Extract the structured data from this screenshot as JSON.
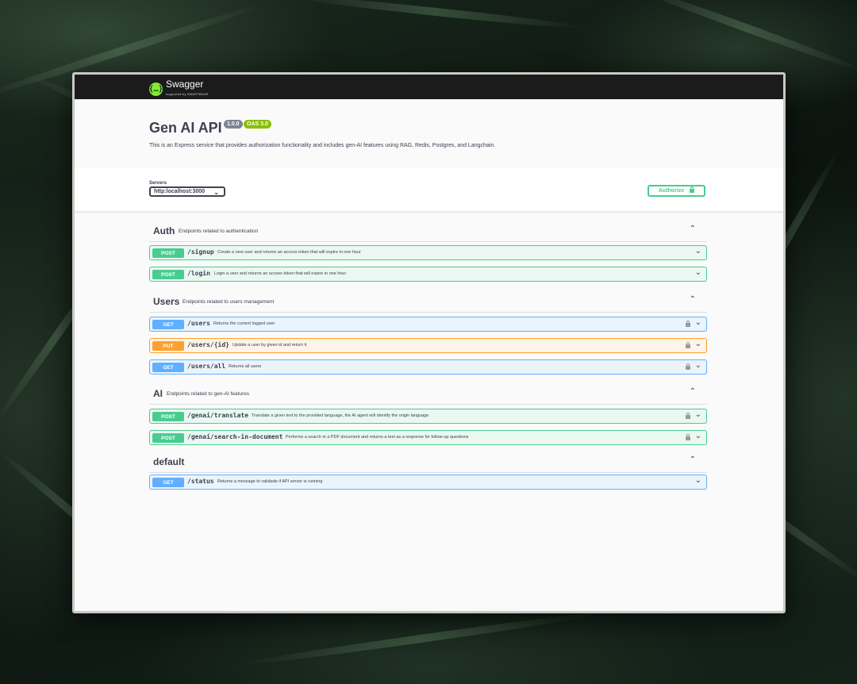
{
  "header": {
    "logo_text": "Swagger",
    "logo_sub": "supported by SMARTBEAR",
    "logo_mark": "{…}"
  },
  "info": {
    "title": "Gen AI API",
    "version": "1.0.0",
    "oas": "OAS 3.0",
    "description": "This is an Express service that provides authorization functionality and includes gen-AI features using RAG, Redis, Postgres, and Langchain."
  },
  "servers": {
    "label": "Servers",
    "selected": "http:localhost:3000"
  },
  "authorize": {
    "label": "Authorize"
  },
  "tags": [
    {
      "name": "Auth",
      "description": "Endpoints related to authentication",
      "ops": [
        {
          "method": "POST",
          "path": "/signup",
          "summary": "Create a new user and returns an access token that will expire in one hour",
          "locked": false
        },
        {
          "method": "POST",
          "path": "/login",
          "summary": "Login a user and returns an access token that will expire in one hour",
          "locked": false
        }
      ]
    },
    {
      "name": "Users",
      "description": "Endpoints related to users management",
      "ops": [
        {
          "method": "GET",
          "path": "/users",
          "summary": "Returns the current logged user",
          "locked": true
        },
        {
          "method": "PUT",
          "path": "/users/{id}",
          "summary": "Update a user by given id and return it",
          "locked": true
        },
        {
          "method": "GET",
          "path": "/users/all",
          "summary": "Returns all users",
          "locked": true
        }
      ]
    },
    {
      "name": "AI",
      "description": "Endpoints related to gen-AI features",
      "ops": [
        {
          "method": "POST",
          "path": "/genai/translate",
          "summary": "Translate a given text to the provided language, the AI agent will identify the origin language",
          "locked": true
        },
        {
          "method": "POST",
          "path": "/genai/search-in-document",
          "summary": "Performs a search in a PDF document and returns a text as a response for follow-up questions",
          "locked": true
        }
      ]
    },
    {
      "name": "default",
      "description": "",
      "ops": [
        {
          "method": "GET",
          "path": "/status",
          "summary": "Returns a message to validade if API server is running",
          "locked": false
        }
      ]
    }
  ],
  "colors": {
    "post": "#49cc90",
    "get": "#61affe",
    "put": "#fca130",
    "topbar": "#1b1b1b",
    "logo": "#85ea2d"
  },
  "icons": {
    "collapse": "chevron-up-icon",
    "expand": "chevron-down-icon",
    "lock": "lock-icon"
  }
}
